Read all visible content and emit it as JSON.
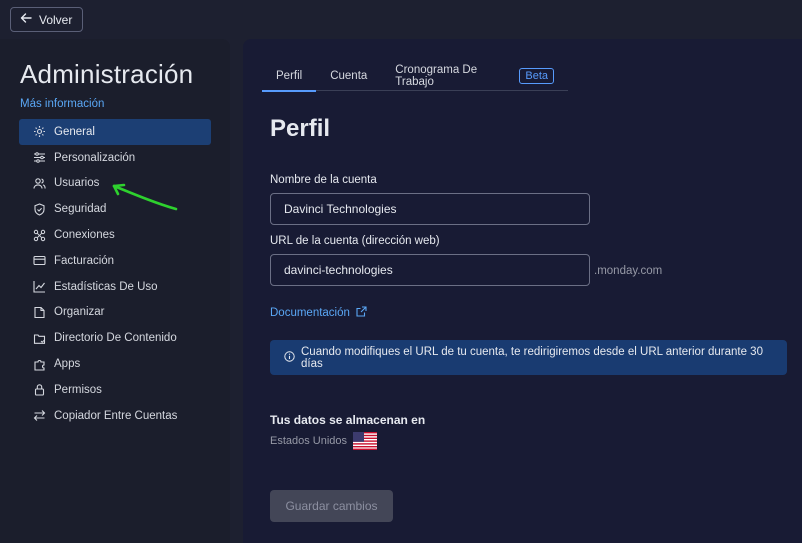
{
  "topbar": {
    "back_label": "Volver"
  },
  "sidebar": {
    "title": "Administración",
    "more_info": "Más información",
    "items": [
      {
        "label": "General",
        "icon": "gear-icon",
        "active": true
      },
      {
        "label": "Personalización",
        "icon": "sliders-icon"
      },
      {
        "label": "Usuarios",
        "icon": "users-icon"
      },
      {
        "label": "Seguridad",
        "icon": "shield-icon"
      },
      {
        "label": "Conexiones",
        "icon": "connections-icon"
      },
      {
        "label": "Facturación",
        "icon": "credit-card-icon"
      },
      {
        "label": "Estadísticas De Uso",
        "icon": "chart-icon"
      },
      {
        "label": "Organizar",
        "icon": "organize-icon"
      },
      {
        "label": "Directorio De Contenido",
        "icon": "folder-icon"
      },
      {
        "label": "Apps",
        "icon": "puzzle-icon"
      },
      {
        "label": "Permisos",
        "icon": "lock-icon"
      },
      {
        "label": "Copiador Entre Cuentas",
        "icon": "swap-icon"
      }
    ]
  },
  "main": {
    "tabs": [
      {
        "label": "Perfil",
        "active": true
      },
      {
        "label": "Cuenta"
      },
      {
        "label": "Cronograma De Trabajo",
        "badge": "Beta"
      }
    ],
    "title": "Perfil",
    "account_name_label": "Nombre de la cuenta",
    "account_name_value": "Davinci Technologies",
    "account_url_label": "URL de la cuenta (dirección web)",
    "account_url_value": "davinci-technologies",
    "account_url_suffix": ".monday.com",
    "documentation_link": "Documentación",
    "info_banner": "Cuando modifiques el URL de tu cuenta, te redirigiremos desde el URL anterior durante 30 días",
    "data_storage_title": "Tus datos se almacenan en",
    "data_storage_country": "Estados Unidos",
    "save_button": "Guardar cambios"
  },
  "colors": {
    "accent": "#579bfc",
    "active_nav": "#1c3f74",
    "banner": "#193b71",
    "annotation": "#2ed12e"
  }
}
